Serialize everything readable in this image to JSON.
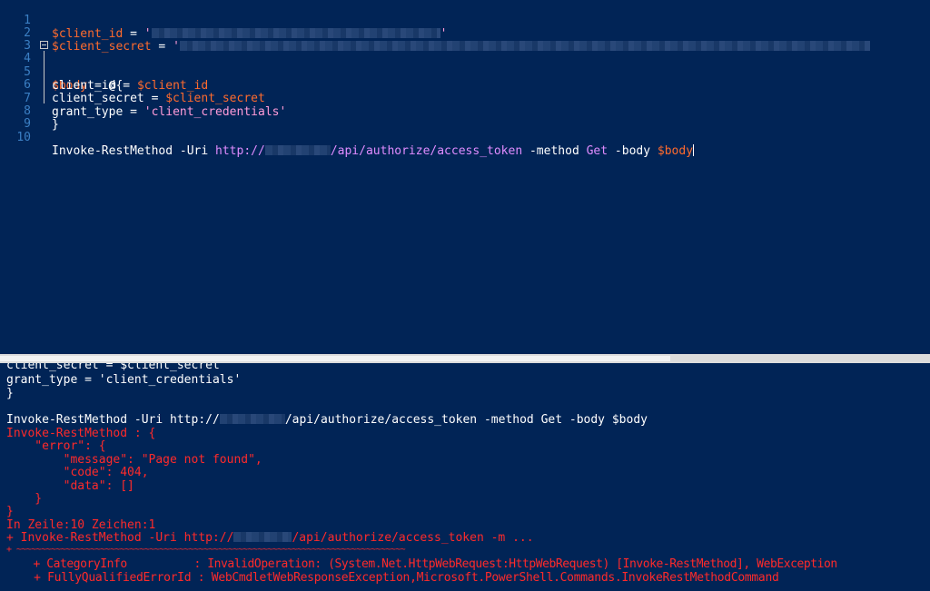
{
  "editor": {
    "lines": [
      {
        "n": "1",
        "var": "$client_id",
        "eq": " = ",
        "str": "'"
      },
      {
        "n": "2",
        "var": "$client_secret",
        "eq": " = ",
        "str": "'"
      },
      {
        "n": "3"
      },
      {
        "n": "4",
        "var": "$body",
        "eq": " = @{"
      },
      {
        "n": "5",
        "key": "client_id",
        "eq": " = ",
        "var": "$client_id"
      },
      {
        "n": "6",
        "key": "client_secret",
        "eq": " = ",
        "var": "$client_secret"
      },
      {
        "n": "7",
        "key": "grant_type",
        "eq": " = ",
        "str": "'client_credentials'"
      },
      {
        "n": "8",
        "text": "}"
      },
      {
        "n": "9"
      },
      {
        "n": "10",
        "cmd": "Invoke-RestMethod",
        "p1": " -Uri ",
        "url_a": "http://",
        "url_b": "/api/authorize/access_token",
        "p2": " -method ",
        "method": "Get",
        "p3": " -body ",
        "var": "$body"
      }
    ]
  },
  "console": {
    "lines": [
      {
        "text": "client_secret = $client_secret",
        "style": "normal"
      },
      {
        "text": "grant_type = 'client_credentials'",
        "style": "normal"
      },
      {
        "text": "}",
        "style": "normal"
      },
      {
        "text": "",
        "style": "normal"
      },
      {
        "text_a": "Invoke-RestMethod -Uri http://",
        "text_b": "/api/authorize/access_token -method Get -body $body",
        "style": "normal",
        "blur": true
      },
      {
        "text": "Invoke-RestMethod : {",
        "style": "error"
      },
      {
        "text": "    \"error\": {",
        "style": "error"
      },
      {
        "text": "        \"message\": \"Page not found\",",
        "style": "error"
      },
      {
        "text": "        \"code\": 404,",
        "style": "error"
      },
      {
        "text": "        \"data\": []",
        "style": "error"
      },
      {
        "text": "    }",
        "style": "error"
      },
      {
        "text": "}",
        "style": "error"
      },
      {
        "text": "In Zeile:10 Zeichen:1",
        "style": "error"
      },
      {
        "text_a": "+ Invoke-RestMethod -Uri http://",
        "text_b": "/api/authorize/access_token -m ...",
        "style": "error",
        "blur": true
      },
      {
        "text": "+ ~~~~~~~~~~~~~~~~~~~~~~~~~~~~~~~~~~~~~~~~~~~~~~~~~~~~~~~~~~~~~~~~~~~~~~~~~~~~~~~",
        "style": "error"
      },
      {
        "text": "    + CategoryInfo          : InvalidOperation: (System.Net.HttpWebRequest:HttpWebRequest) [Invoke-RestMethod], WebException",
        "style": "error"
      },
      {
        "text": "    + FullyQualifiedErrorId : WebCmdletWebResponseException,Microsoft.PowerShell.Commands.InvokeRestMethodCommand",
        "style": "error"
      }
    ]
  }
}
